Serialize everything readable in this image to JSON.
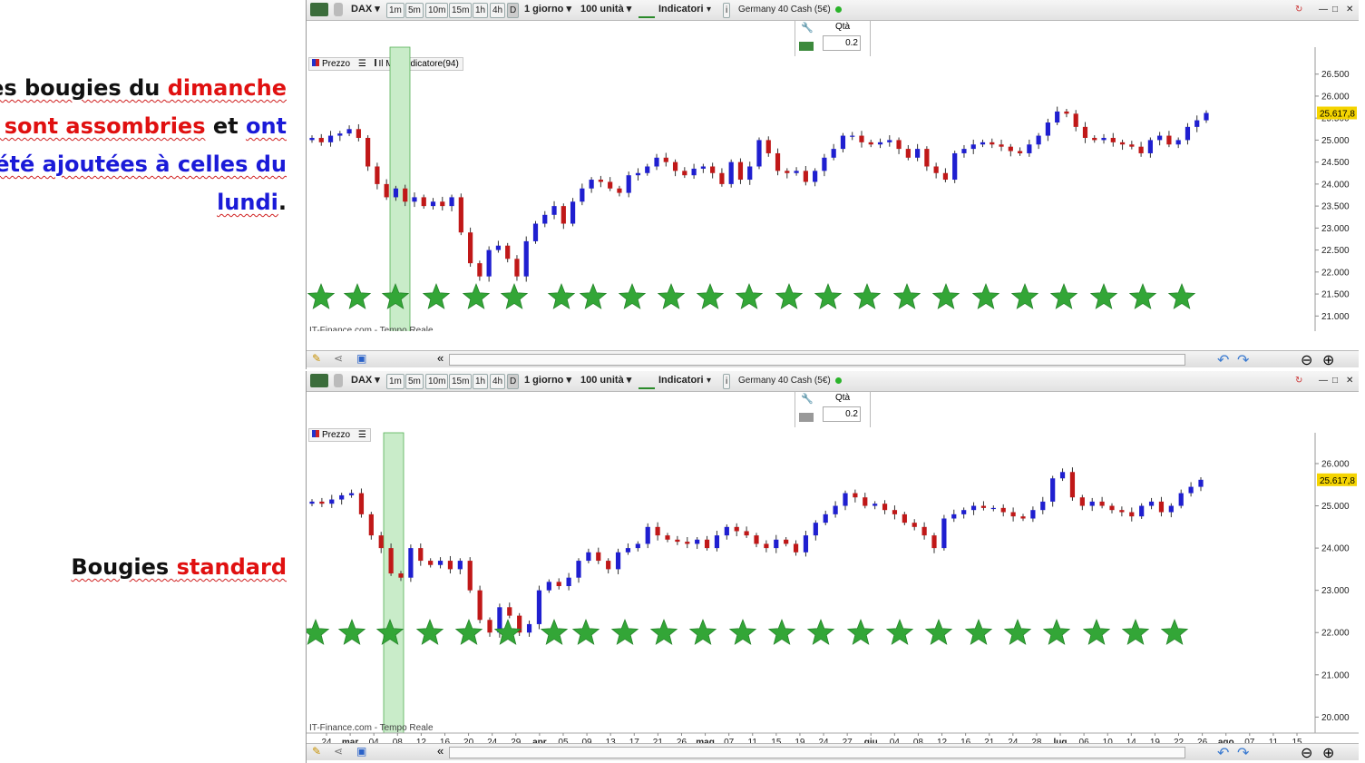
{
  "annotations": {
    "top_line1_a": "Les bougies du ",
    "top_line1_b": "dimanche",
    "top_line2_a": "se sont assombries",
    "top_line2_b": " et ",
    "top_line2_c": "ont",
    "top_line3": "été ajoutées à celles du",
    "top_line4_a": "lundi",
    "top_line4_b": ".",
    "bottom_a": "Bougies ",
    "bottom_b": "standard"
  },
  "toolbar": {
    "symbol": "DAX",
    "timeframes": [
      "1m",
      "5m",
      "10m",
      "15m",
      "1h",
      "4h",
      "D"
    ],
    "period": "1 giorno",
    "units": "100 unità",
    "indicators": "Indicatori",
    "instrument": "Germany 40 Cash (5€)",
    "info": "i"
  },
  "order": {
    "qty_label": "Qtà",
    "qty_value": "0.2"
  },
  "top_chart": {
    "legend_price": "Prezzo",
    "legend_indicator": "Il Mio Indicatore(94)",
    "watermark": "IT-Finance.com - Tempo Reale",
    "last_price": "25.617,8",
    "y_ticks": [
      "26.500",
      "26.000",
      "25.500",
      "25.000",
      "24.500",
      "24.000",
      "23.500",
      "23.000",
      "22.500",
      "22.000",
      "21.500",
      "21.000"
    ]
  },
  "bottom_chart": {
    "legend_price": "Prezzo",
    "watermark": "IT-Finance.com - Tempo Reale",
    "last_price": "25.617,8",
    "y_ticks": [
      "26.000",
      "25.000",
      "24.000",
      "23.000",
      "22.000",
      "21.000",
      "20.000"
    ]
  },
  "x_ticks": [
    "24",
    "mar",
    "04",
    "08",
    "12",
    "16",
    "20",
    "24",
    "29",
    "apr",
    "05",
    "09",
    "13",
    "17",
    "21",
    "26",
    "mag",
    "07",
    "11",
    "15",
    "19",
    "24",
    "27",
    "giu",
    "04",
    "08",
    "12",
    "16",
    "21",
    "24",
    "28",
    "lug",
    "06",
    "10",
    "14",
    "19",
    "22",
    "26",
    "ago",
    "07",
    "11",
    "15"
  ],
  "colors": {
    "up": "#1f1fd0",
    "down": "#c01818",
    "star": "#33a637",
    "highlight": "#c9ecc9",
    "last_price_bg": "#f5d400"
  },
  "chart_data": [
    {
      "type": "candlestick",
      "title": "",
      "legend": [
        "Prezzo",
        "Il Mio Indicatore(94)"
      ],
      "ylim": [
        20800,
        26700
      ],
      "close": [
        25050,
        24950,
        25100,
        25150,
        25250,
        25050,
        24400,
        24000,
        23700,
        23900,
        23600,
        23700,
        23500,
        23600,
        23500,
        23700,
        22900,
        22200,
        21900,
        22500,
        22600,
        22300,
        21900,
        22700,
        23100,
        23300,
        23500,
        23100,
        23600,
        23900,
        24100,
        24050,
        23900,
        23800,
        24200,
        24250,
        24400,
        24600,
        24500,
        24300,
        24200,
        24350,
        24400,
        24250,
        24000,
        24500,
        24100,
        24400,
        25000,
        24700,
        24300,
        24250,
        24300,
        24050,
        24300,
        24600,
        24800,
        25100,
        25100,
        24950,
        24900,
        24950,
        25000,
        24800,
        24600,
        24800,
        24400,
        24250,
        24100,
        24700,
        24800,
        24900,
        24950,
        24900,
        24850,
        24750,
        24700,
        24900,
        25100,
        25400,
        25650,
        25600,
        25300,
        25050,
        25000,
        25050,
        24950,
        24900,
        24850,
        24700,
        25000,
        25100,
        24900,
        25000,
        25300,
        25450,
        25617
      ]
    },
    {
      "type": "candlestick",
      "title": "",
      "legend": [
        "Prezzo"
      ],
      "ylim": [
        19600,
        26300
      ],
      "close": [
        25100,
        25050,
        25150,
        25250,
        25300,
        24800,
        24300,
        24000,
        23400,
        23300,
        24000,
        23700,
        23600,
        23700,
        23500,
        23700,
        23000,
        22300,
        22000,
        22600,
        22400,
        22000,
        22200,
        23000,
        23200,
        23100,
        23300,
        23700,
        23900,
        23700,
        23500,
        23900,
        24000,
        24100,
        24500,
        24300,
        24200,
        24150,
        24100,
        24200,
        24000,
        24300,
        24500,
        24400,
        24300,
        24100,
        24000,
        24200,
        24100,
        23900,
        24300,
        24600,
        24800,
        25000,
        25300,
        25200,
        25000,
        25050,
        24900,
        24800,
        24600,
        24500,
        24300,
        24000,
        24700,
        24800,
        24900,
        25000,
        24950,
        24950,
        24850,
        24750,
        24700,
        24900,
        25100,
        25650,
        25800,
        25200,
        25000,
        25100,
        25000,
        24900,
        24850,
        24750,
        25000,
        25100,
        24850,
        25000,
        25300,
        25450,
        25617
      ]
    }
  ]
}
